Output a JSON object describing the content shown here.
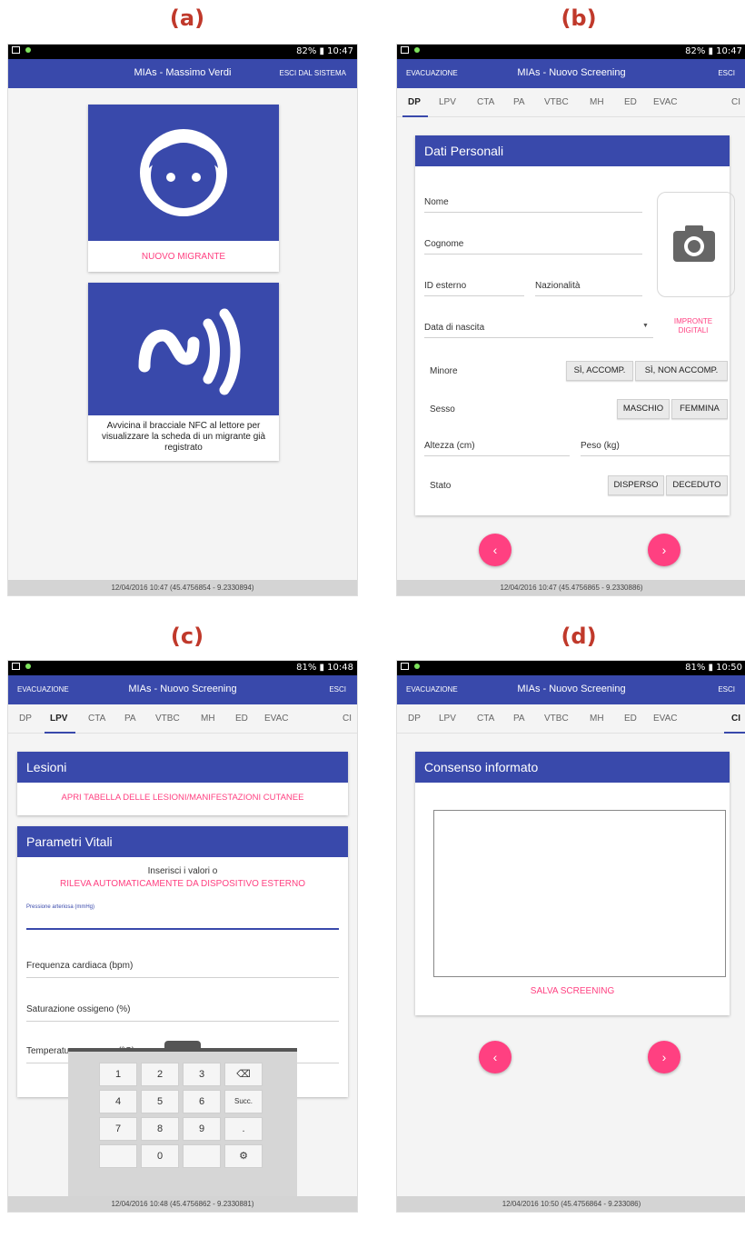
{
  "panels": {
    "a": {
      "label": "(a)",
      "status_right": "82% ▮ 10:47",
      "app_title": "MIAs - Massimo Verdi",
      "exit": "ESCI DAL SISTEMA",
      "new_migrant": "NUOVO MIGRANTE",
      "nfc_text": "Avvicina il bracciale NFC al lettore per visualizzare la scheda di un migrante già registrato",
      "footer": "12/04/2016 10:47    (45.4756854 - 9.2330894)"
    },
    "b": {
      "label": "(b)",
      "status_right": "82% ▮ 10:47",
      "left_action": "EVACUAZIONE",
      "app_title": "MIAs - Nuovo Screening",
      "right_action": "ESCI",
      "tabs": [
        "DP",
        "LPV",
        "CTA",
        "PA",
        "VTBC",
        "MH",
        "ED",
        "EVAC",
        "CI"
      ],
      "card_title": "Dati Personali",
      "nome": "Nome",
      "cognome": "Cognome",
      "id_esterno": "ID esterno",
      "nazionalita": "Nazionalità",
      "data_nascita": "Data di nascita",
      "impronte": "IMPRONTE DIGITALI",
      "minore": "Minore",
      "minore_opts": [
        "SÌ, ACCOMP.",
        "SÌ, NON ACCOMP."
      ],
      "sesso": "Sesso",
      "sesso_opts": [
        "MASCHIO",
        "FEMMINA"
      ],
      "altezza": "Altezza (cm)",
      "peso": "Peso (kg)",
      "stato": "Stato",
      "stato_opts": [
        "DISPERSO",
        "DECEDUTO"
      ],
      "footer": "12/04/2016 10:47    (45.4756865 - 9.2330886)"
    },
    "c": {
      "label": "(c)",
      "status_right": "81% ▮ 10:48",
      "left_action": "EVACUAZIONE",
      "app_title": "MIAs - Nuovo Screening",
      "right_action": "ESCI",
      "tabs": [
        "DP",
        "LPV",
        "CTA",
        "PA",
        "VTBC",
        "MH",
        "ED",
        "EVAC",
        "CI"
      ],
      "lesioni_title": "Lesioni",
      "lesioni_link": "APRI TABELLA DELLE LESIONI/MANIFESTAZIONI CUTANEE",
      "vitali_title": "Parametri Vitali",
      "insert_text": "Inserisci i valori o",
      "auto_link": "RILEVA AUTOMATICAMENTE DA DISPOSITIVO ESTERNO",
      "pressione": "Pressione arteriosa (mmHg)",
      "frequenza": "Frequenza cardiaca (bpm)",
      "saturazione": "Saturazione ossigeno (%)",
      "temperatura": "Temperatura corporea (°C)",
      "keys": [
        "1",
        "2",
        "3",
        "⌫",
        "4",
        "5",
        "6",
        "Succ.",
        "7",
        "8",
        "9",
        ".",
        "",
        "0",
        "",
        "⚙"
      ],
      "footer": "12/04/2016 10:48    (45.4756862 - 9.2330881)"
    },
    "d": {
      "label": "(d)",
      "status_right": "81% ▮ 10:50",
      "left_action": "EVACUAZIONE",
      "app_title": "MIAs - Nuovo Screening",
      "right_action": "ESCI",
      "tabs": [
        "DP",
        "LPV",
        "CTA",
        "PA",
        "VTBC",
        "MH",
        "ED",
        "EVAC",
        "CI"
      ],
      "card_title": "Consenso informato",
      "save": "SALVA SCREENING",
      "footer": "12/04/2016 10:50    (45.4756864 - 9.233086)"
    }
  },
  "colors": {
    "primary": "#3949ab",
    "accent": "#ff4081",
    "background": "#f4f4f4"
  }
}
